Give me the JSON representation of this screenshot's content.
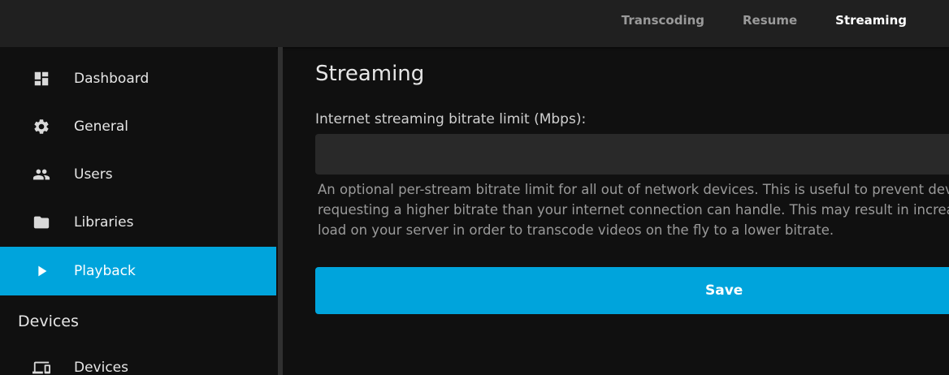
{
  "header": {
    "tabs": [
      {
        "label": "Transcoding",
        "active": false
      },
      {
        "label": "Resume",
        "active": false
      },
      {
        "label": "Streaming",
        "active": true
      }
    ]
  },
  "sidebar": {
    "items": [
      {
        "label": "Dashboard",
        "icon": "dashboard-icon"
      },
      {
        "label": "General",
        "icon": "gear-icon"
      },
      {
        "label": "Users",
        "icon": "users-icon"
      },
      {
        "label": "Libraries",
        "icon": "folder-icon"
      },
      {
        "label": "Playback",
        "icon": "play-icon",
        "active": true
      }
    ],
    "section_devices": {
      "title": "Devices",
      "items": [
        {
          "label": "Devices",
          "icon": "devices-icon"
        }
      ]
    }
  },
  "main": {
    "title": "Streaming",
    "bitrate_field": {
      "label": "Internet streaming bitrate limit (Mbps):",
      "value": "",
      "description": "An optional per-stream bitrate limit for all out of network devices. This is useful to prevent devices from requesting a higher bitrate than your internet connection can handle. This may result in increased CPU load on your server in order to transcode videos on the fly to a lower bitrate."
    },
    "save_label": "Save"
  },
  "colors": {
    "accent": "#00a4dc",
    "background": "#101010",
    "header": "#202020",
    "input": "#292929"
  }
}
